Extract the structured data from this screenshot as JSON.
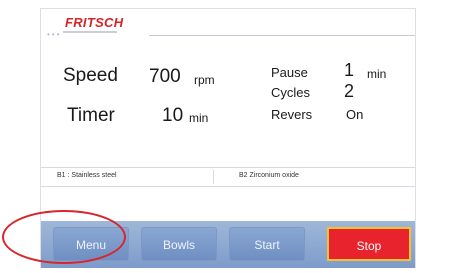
{
  "brand": {
    "logo_text": "FRITSCH",
    "logo_color": "#d3242a"
  },
  "params": {
    "speed": {
      "label": "Speed",
      "value": "700",
      "unit": "rpm"
    },
    "timer": {
      "label": "Timer",
      "value": "10",
      "unit": "min"
    },
    "pause": {
      "label": "Pause",
      "value": "1",
      "unit": "min"
    },
    "cycles": {
      "label": "Cycles",
      "value": "2"
    },
    "revers": {
      "label": "Revers",
      "value": "On"
    }
  },
  "bowls": {
    "b1": "B1 : Stainless steel",
    "b2": "B2  Zirconium oxide"
  },
  "buttons": {
    "menu": "Menu",
    "bowls": "Bowls",
    "start": "Start",
    "stop": "Stop"
  },
  "colors": {
    "stop": "#e8232d",
    "stop_border": "#f2c233",
    "button_bar": "#7d9ccb",
    "highlight_ring": "#d7262c"
  }
}
